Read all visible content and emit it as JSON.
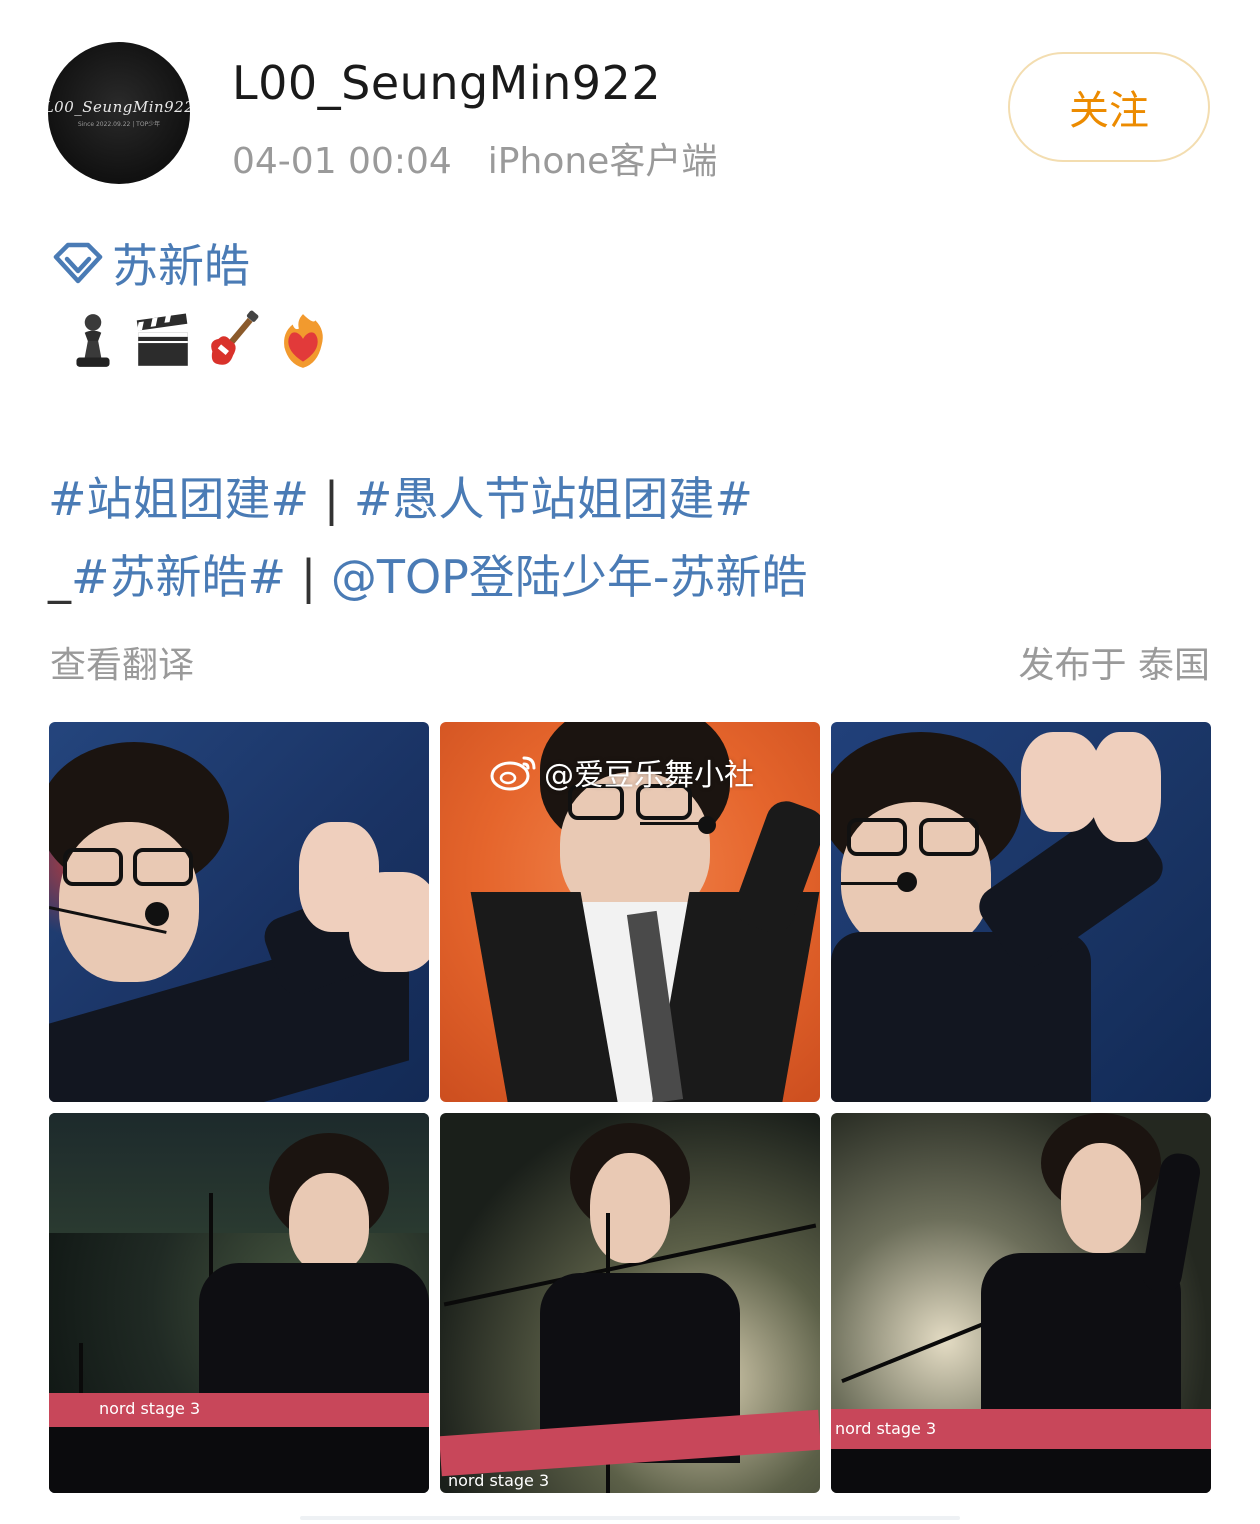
{
  "user": {
    "avatar_signature": "L00_SeungMin922",
    "avatar_subtext": "Since 2022.09.22 | TOP少年",
    "name": "L00_SeungMin922",
    "timestamp": "04-01 00:04",
    "source": "iPhone客户端"
  },
  "follow_button": {
    "label": "关注",
    "color": "#ec8b00"
  },
  "post": {
    "super_topic": {
      "icon": "diamond-icon",
      "label": "苏新皓"
    },
    "emojis": [
      "chess-pawn-icon",
      "clapper-board-icon",
      "guitar-icon",
      "heart-on-fire-icon"
    ],
    "tags_line1": [
      {
        "text": "#站姐团建#",
        "type": "link"
      },
      {
        "text": " | ",
        "type": "plain"
      },
      {
        "text": "#愚人节站姐团建#",
        "type": "link"
      }
    ],
    "tags_line2": [
      {
        "text": "_",
        "type": "plain"
      },
      {
        "text": "#苏新皓#",
        "type": "link"
      },
      {
        "text": " | ",
        "type": "plain"
      },
      {
        "text": "@TOP登陆少年-苏新皓",
        "type": "link"
      }
    ],
    "translate_label": "查看翻译",
    "location_label": "发布于 泰国"
  },
  "photos": {
    "watermark": "@爱豆乐舞小社",
    "keyboard_label": "nord stage 3"
  },
  "colors": {
    "link": "#4a7bb5",
    "muted": "#9a9a9a",
    "stage_blue": "#1c3566",
    "stage_orange": "#e86a2a"
  }
}
